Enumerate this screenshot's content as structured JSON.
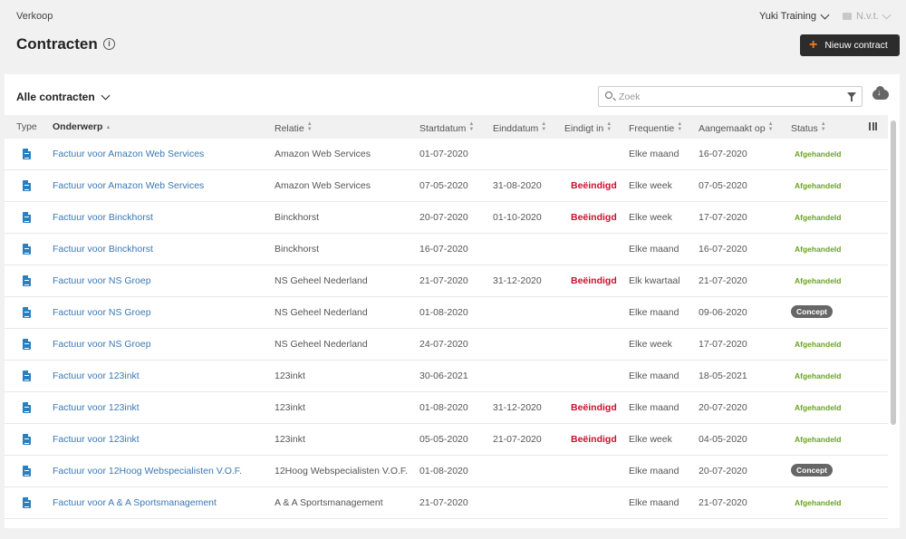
{
  "breadcrumb": "Verkoop",
  "page_title": "Contracten",
  "company": "Yuki Training",
  "year": "N.v.t.",
  "new_button": "Nieuw contract",
  "view_selector": "Alle contracten",
  "search": {
    "placeholder": "Zoek",
    "value": ""
  },
  "columns": {
    "type": "Type",
    "onderwerp": "Onderwerp",
    "relatie": "Relatie",
    "startdatum": "Startdatum",
    "einddatum": "Einddatum",
    "eindigt_in": "Eindigt in",
    "frequentie": "Frequentie",
    "aangemaakt_op": "Aangemaakt op",
    "status": "Status"
  },
  "rows": [
    {
      "subject": "Factuur voor Amazon Web Services",
      "relation": "Amazon Web Services",
      "start": "01-07-2020",
      "end": "",
      "ends_in": "",
      "frequency": "Elke maand",
      "created": "16-07-2020",
      "status": "Afgehandeld"
    },
    {
      "subject": "Factuur voor Amazon Web Services",
      "relation": "Amazon Web Services",
      "start": "07-05-2020",
      "end": "31-08-2020",
      "ends_in": "Beëindigd",
      "frequency": "Elke week",
      "created": "07-05-2020",
      "status": "Afgehandeld"
    },
    {
      "subject": "Factuur voor Binckhorst",
      "relation": "Binckhorst",
      "start": "20-07-2020",
      "end": "01-10-2020",
      "ends_in": "Beëindigd",
      "frequency": "Elke week",
      "created": "17-07-2020",
      "status": "Afgehandeld"
    },
    {
      "subject": "Factuur voor Binckhorst",
      "relation": "Binckhorst",
      "start": "16-07-2020",
      "end": "",
      "ends_in": "",
      "frequency": "Elke maand",
      "created": "16-07-2020",
      "status": "Afgehandeld"
    },
    {
      "subject": "Factuur voor NS Groep",
      "relation": "NS Geheel Nederland",
      "start": "21-07-2020",
      "end": "31-12-2020",
      "ends_in": "Beëindigd",
      "frequency": "Elk kwartaal",
      "created": "21-07-2020",
      "status": "Afgehandeld"
    },
    {
      "subject": "Factuur voor NS Groep",
      "relation": "NS Geheel Nederland",
      "start": "01-08-2020",
      "end": "",
      "ends_in": "",
      "frequency": "Elke maand",
      "created": "09-06-2020",
      "status": "Concept"
    },
    {
      "subject": "Factuur voor NS Groep",
      "relation": "NS Geheel Nederland",
      "start": "24-07-2020",
      "end": "",
      "ends_in": "",
      "frequency": "Elke week",
      "created": "17-07-2020",
      "status": "Afgehandeld"
    },
    {
      "subject": "Factuur voor 123inkt",
      "relation": "123inkt",
      "start": "30-06-2021",
      "end": "",
      "ends_in": "",
      "frequency": "Elke maand",
      "created": "18-05-2021",
      "status": "Afgehandeld"
    },
    {
      "subject": "Factuur voor 123inkt",
      "relation": "123inkt",
      "start": "01-08-2020",
      "end": "31-12-2020",
      "ends_in": "Beëindigd",
      "frequency": "Elke maand",
      "created": "20-07-2020",
      "status": "Afgehandeld"
    },
    {
      "subject": "Factuur voor 123inkt",
      "relation": "123inkt",
      "start": "05-05-2020",
      "end": "21-07-2020",
      "ends_in": "Beëindigd",
      "frequency": "Elke week",
      "created": "04-05-2020",
      "status": "Afgehandeld"
    },
    {
      "subject": "Factuur voor 12Hoog Webspecialisten V.O.F.",
      "relation": "12Hoog Webspecialisten V.O.F.",
      "start": "01-08-2020",
      "end": "",
      "ends_in": "",
      "frequency": "Elke maand",
      "created": "20-07-2020",
      "status": "Concept"
    },
    {
      "subject": "Factuur voor A & A Sportsmanagement",
      "relation": "A & A Sportsmanagement",
      "start": "21-07-2020",
      "end": "",
      "ends_in": "",
      "frequency": "Elke maand",
      "created": "21-07-2020",
      "status": "Afgehandeld"
    }
  ],
  "colors": {
    "accent": "#f07d1d",
    "link": "#3a78b5",
    "ended": "#c8102e",
    "done": "#6aa31f",
    "concept": "#666666",
    "doc_icon": "#2a7fbf"
  },
  "icons": {
    "info": "info-icon",
    "dropdown": "chevron-down-icon",
    "search": "search-icon",
    "filter": "filter-icon",
    "download": "cloud-download-icon",
    "columns": "columns-icon",
    "row_type": "document-icon"
  }
}
